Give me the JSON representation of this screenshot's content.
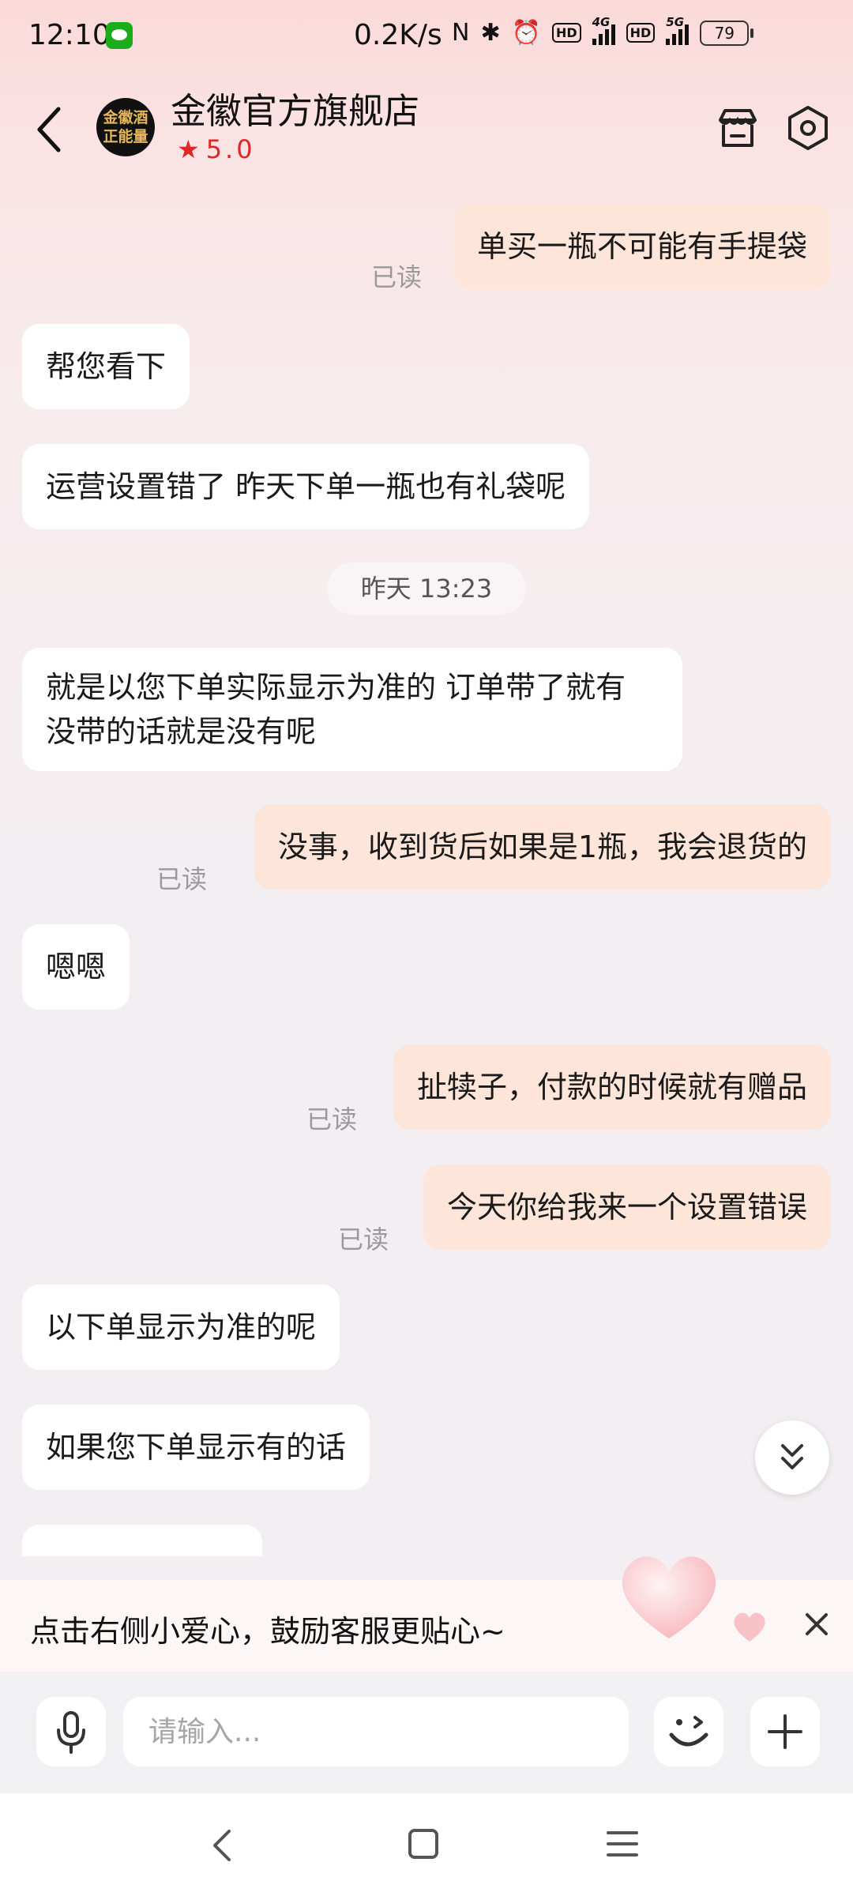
{
  "status_bar": {
    "time": "12:10",
    "net_speed": "0.2K/s",
    "network_1": "4G",
    "network_2": "5G",
    "hd_label": "HD",
    "battery": "79"
  },
  "header": {
    "shop_name": "金徽官方旗舰店",
    "avatar_line1": "金徽酒",
    "avatar_line2": "正能量",
    "rating": "5.0"
  },
  "messages": [
    {
      "side": "out",
      "text": "单买一瓶不可能有手提袋",
      "read": "已读"
    },
    {
      "side": "in",
      "text": "帮您看下"
    },
    {
      "side": "in",
      "text": "运营设置错了  昨天下单一瓶也有礼袋呢"
    },
    {
      "side": "in",
      "text": "就是以您下单实际显示为准的  订单带了就有  没带的话就是没有呢"
    },
    {
      "side": "out",
      "text": "没事，收到货后如果是1瓶，我会退货的",
      "read": "已读"
    },
    {
      "side": "in",
      "text": "嗯嗯"
    },
    {
      "side": "out",
      "text": "扯犊子，付款的时候就有赠品",
      "read": "已读"
    },
    {
      "side": "out",
      "text": "今天你给我来一个设置错误",
      "read": "已读"
    },
    {
      "side": "in",
      "text": "以下单显示为准的呢"
    },
    {
      "side": "in",
      "text": "如果您下单显示有的话"
    }
  ],
  "timestamp": "昨天  13:23",
  "tip": {
    "text": "点击右侧小爱心，鼓励客服更贴心~"
  },
  "input": {
    "placeholder": "请输入..."
  },
  "icons": {
    "back": "chevron-left-icon",
    "store": "store-icon",
    "settings": "settings-hexagon-icon",
    "scroll": "double-chevron-down-icon",
    "mic": "microphone-icon",
    "emoji": "emoji-wink-icon",
    "plus": "plus-icon",
    "heart": "heart-icon",
    "close": "close-icon"
  },
  "colors": {
    "outgoing_bubble": "#fde5da",
    "incoming_bubble": "#ffffff",
    "rating": "#e02626"
  }
}
